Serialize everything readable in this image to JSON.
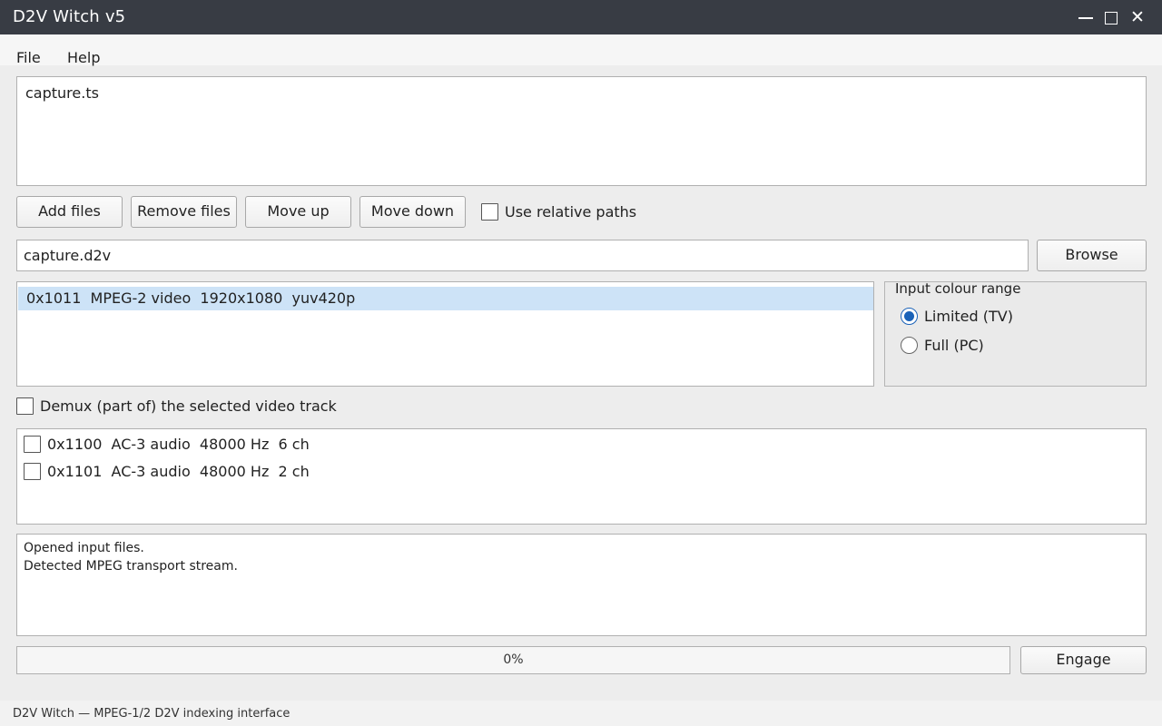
{
  "window": {
    "title": "D2V Witch v5",
    "minimize": "—",
    "close": "✕"
  },
  "menu": {
    "file": "File",
    "help": "Help"
  },
  "input_files": [
    "capture.ts"
  ],
  "buttons": {
    "add_files": "Add files",
    "remove_files": "Remove files",
    "move_up": "Move up",
    "move_down": "Move down",
    "browse": "Browse",
    "engage": "Engage"
  },
  "relative_paths": {
    "label": "Use relative paths",
    "checked": false
  },
  "output_path": "capture.d2v",
  "video_tracks": [
    "0x1011  MPEG-2 video  1920x1080  yuv420p"
  ],
  "colour_range": {
    "title": "Input colour range",
    "options": [
      "Limited (TV)",
      "Full (PC)"
    ],
    "selected": "Limited (TV)"
  },
  "demux_video": {
    "label": "Demux (part of) the selected video track",
    "checked": false
  },
  "audio_tracks": [
    {
      "label": "0x1100  AC-3 audio  48000 Hz  6 ch",
      "checked": false
    },
    {
      "label": "0x1101  AC-3 audio  48000 Hz  2 ch",
      "checked": false
    }
  ],
  "log": [
    "Opened input files.",
    "Detected MPEG transport stream."
  ],
  "progress": {
    "value": 0,
    "text": "0%"
  },
  "status": "D2V Witch — MPEG-1/2 D2V indexing interface"
}
